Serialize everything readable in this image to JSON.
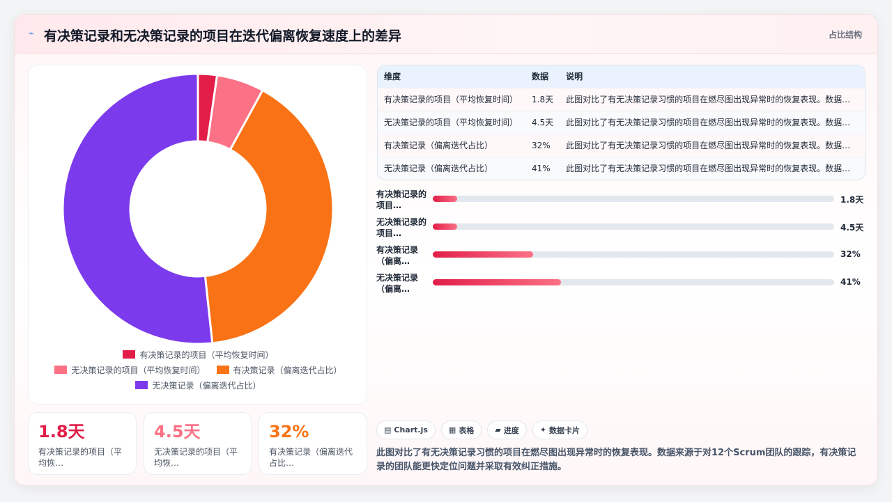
{
  "header": {
    "title": "有决策记录和无决策记录的项目在迭代偏离恢复速度上的差异",
    "tag": "占比结构",
    "icon": "sparkline-icon"
  },
  "colors": {
    "accent": "#e11d48",
    "pink": "#fb7185",
    "orange": "#f97316",
    "purple": "#7c3aed",
    "track": "#e3e8ef"
  },
  "chart_data": {
    "type": "pie",
    "variant": "doughnut",
    "labels": [
      "有决策记录的项目（平均恢复时间）",
      "无决策记录的项目（平均恢复时间）",
      "有决策记录（偏离迭代占比）",
      "无决策记录（偏离迭代占比）"
    ],
    "values": [
      1.8,
      4.5,
      32,
      41
    ],
    "colors": [
      "#e11d48",
      "#fb7185",
      "#f97316",
      "#7c3aed"
    ],
    "legend": "bottom"
  },
  "legend": [
    {
      "label": "有决策记录的项目（平均恢复时间）",
      "color": "#e11d48"
    },
    {
      "label": "无决策记录的项目（平均恢复时间）",
      "color": "#fb7185"
    },
    {
      "label": "有决策记录（偏离迭代占比）",
      "color": "#f97316"
    },
    {
      "label": "无决策记录（偏离迭代占比）",
      "color": "#7c3aed"
    }
  ],
  "stats": [
    {
      "value": "1.8天",
      "label": "有决策记录的项目（平均恢…",
      "color": "#e11d48"
    },
    {
      "value": "4.5天",
      "label": "无决策记录的项目（平均恢…",
      "color": "#fb7185"
    },
    {
      "value": "32%",
      "label": "有决策记录（偏离迭代占比…",
      "color": "#f97316"
    }
  ],
  "table": {
    "headers": [
      "维度",
      "数据",
      "说明"
    ],
    "rows": [
      [
        "有决策记录的项目（平均恢复时间）",
        "1.8天",
        "此图对比了有无决策记录习惯的项目在燃尽图出现异常时的恢复表现。数据来…"
      ],
      [
        "无决策记录的项目（平均恢复时间）",
        "4.5天",
        "此图对比了有无决策记录习惯的项目在燃尽图出现异常时的恢复表现。数据来…"
      ],
      [
        "有决策记录（偏离迭代占比）",
        "32%",
        "此图对比了有无决策记录习惯的项目在燃尽图出现异常时的恢复表现。数据来…"
      ],
      [
        "无决策记录（偏离迭代占比）",
        "41%",
        "此图对比了有无决策记录习惯的项目在燃尽图出现异常时的恢复表现。数据来…"
      ]
    ]
  },
  "bars": [
    {
      "name": "有决策记录的项目…",
      "value": "1.8天",
      "fraction": 0.0614
    },
    {
      "name": "无决策记录的项目…",
      "value": "4.5天",
      "fraction": 0.0614
    },
    {
      "name": "有决策记录（偏离…",
      "value": "32%",
      "fraction": 0.25
    },
    {
      "name": "无决策记录（偏离…",
      "value": "41%",
      "fraction": 0.32
    }
  ],
  "chips": [
    {
      "icon": "chart-icon",
      "glyph": "▤",
      "label": "Chart.js"
    },
    {
      "icon": "table-icon",
      "glyph": "▦",
      "label": "表格"
    },
    {
      "icon": "progress-icon",
      "glyph": "▰",
      "label": "进度"
    },
    {
      "icon": "card-icon",
      "glyph": "✦",
      "label": "数据卡片"
    }
  ],
  "description": "此图对比了有无决策记录习惯的项目在燃尽图出现异常时的恢复表现。数据来源于对12个Scrum团队的跟踪，有决策记录的团队能更快定位问题并采取有效纠正措施。"
}
